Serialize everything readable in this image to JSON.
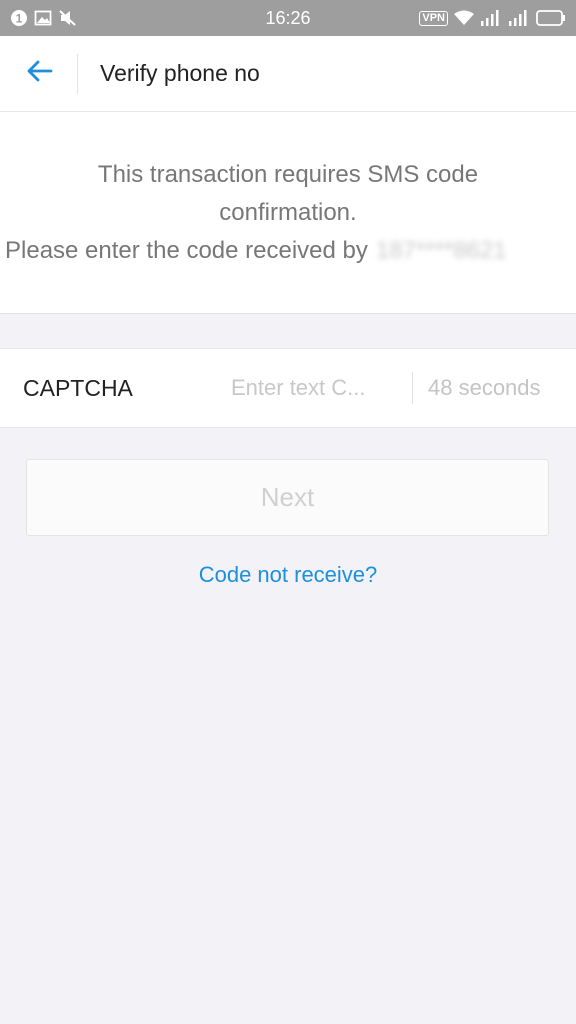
{
  "status_bar": {
    "time": "16:26",
    "vpn": "VPN",
    "left_icons": [
      "notification-badge-icon",
      "image-icon",
      "mute-icon"
    ],
    "right_icons": [
      "wifi-icon",
      "signal-icon",
      "signal-icon",
      "battery-icon"
    ]
  },
  "header": {
    "title": "Verify phone no",
    "back_icon": "arrow-left-icon",
    "accent_color": "#1e8fdc"
  },
  "message": {
    "line1": "This transaction requires SMS code",
    "line2": "confirmation.",
    "line3": "Please enter the code received by",
    "phone_masked": "187****8621"
  },
  "captcha": {
    "label": "CAPTCHA",
    "placeholder": "Enter text C...",
    "value": "",
    "countdown": "48 seconds"
  },
  "actions": {
    "next_label": "Next",
    "help_link": "Code not receive?"
  }
}
